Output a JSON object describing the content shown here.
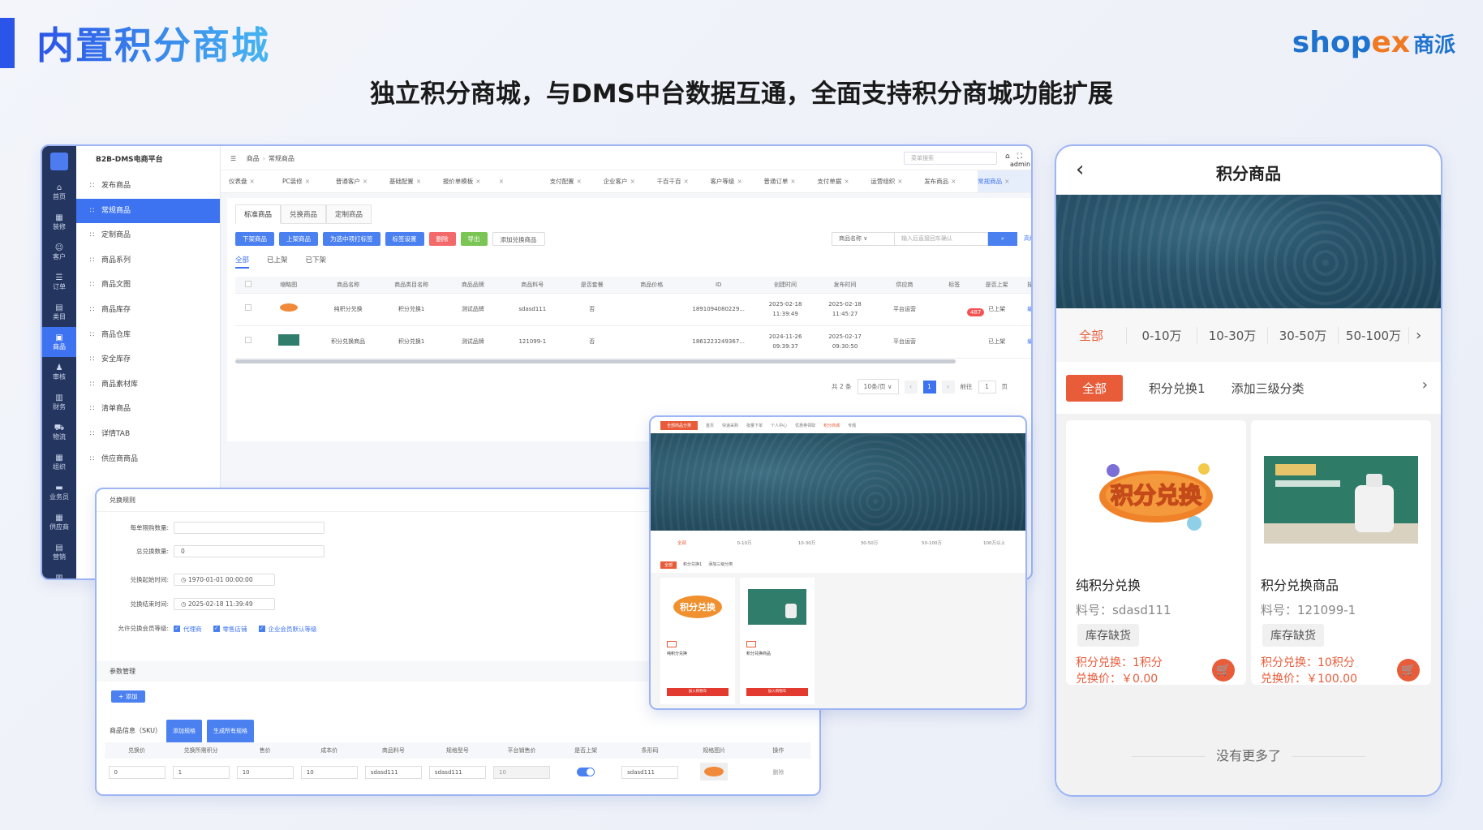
{
  "slide": {
    "title": "内置积分商城",
    "subtitle": "独立积分商城，与DMS中台数据互通，全面支持积分商城功能扩展",
    "brand": {
      "main": "shop",
      "x": "ex",
      "cn": "商派"
    }
  },
  "admin": {
    "app_title": "B2B-DMS电商平台",
    "rail": [
      {
        "icon": "home-icon",
        "glyph": "⌂",
        "label": "首页"
      },
      {
        "icon": "grid-icon",
        "glyph": "▦",
        "label": "装修"
      },
      {
        "icon": "user-icon",
        "glyph": "☺",
        "label": "客户"
      },
      {
        "icon": "order-icon",
        "glyph": "☰",
        "label": "订单"
      },
      {
        "icon": "category-icon",
        "glyph": "▤",
        "label": "类目"
      },
      {
        "icon": "goods-icon",
        "glyph": "▣",
        "label": "商品",
        "active": true
      },
      {
        "icon": "audit-icon",
        "glyph": "♟",
        "label": "审核"
      },
      {
        "icon": "finance-icon",
        "glyph": "▥",
        "label": "财务"
      },
      {
        "icon": "truck-icon",
        "glyph": "⛟",
        "label": "物流"
      },
      {
        "icon": "org-icon",
        "glyph": "▦",
        "label": "组织"
      },
      {
        "icon": "sales-icon",
        "glyph": "▬",
        "label": "业务员"
      },
      {
        "icon": "supplier-icon",
        "glyph": "▦",
        "label": "供应商"
      },
      {
        "icon": "marketing-icon",
        "glyph": "▤",
        "label": "营销"
      },
      {
        "icon": "report-icon",
        "glyph": "▥",
        "label": "报表"
      }
    ],
    "side_items": [
      "发布商品",
      "常规商品",
      "定制商品",
      "商品系列",
      "商品文图",
      "商品库存",
      "商品仓库",
      "安全库存",
      "商品素材库",
      "清单商品",
      "详情TAB",
      "供应商商品"
    ],
    "side_active": 1,
    "breadcrumb": [
      "商品",
      "常规商品"
    ],
    "search_placeholder": "菜单搜索",
    "user": "admin",
    "tabs": [
      "仪表盘",
      "PC装修",
      "普通客户",
      "基础配置",
      "报价单模板",
      "",
      "支付配置",
      "企业客户",
      "千百千百",
      "客户等级",
      "普通订单",
      "支付单据",
      "运营组织",
      "发布商品",
      "常规商品"
    ],
    "tab_active": 14,
    "subtabs": [
      "标准商品",
      "兑换商品",
      "定制商品"
    ],
    "buttons": [
      {
        "label": "下架商品",
        "style": "blue"
      },
      {
        "label": "上架商品",
        "style": "blue"
      },
      {
        "label": "为选中项打标签",
        "style": "blue"
      },
      {
        "label": "标签设置",
        "style": "blue"
      },
      {
        "label": "删除",
        "style": "red"
      },
      {
        "label": "导出",
        "style": "green"
      },
      {
        "label": "添加兑换商品",
        "style": "plain"
      }
    ],
    "filter": {
      "field": "商品名称",
      "placeholder": "输入后直接回车确认",
      "more": "高级筛选 ›"
    },
    "status_tabs": [
      "全部",
      "已上架",
      "已下架"
    ],
    "table_headers": [
      "",
      "缩略图",
      "商品名称",
      "商品类目名称",
      "商品品牌",
      "商品料号",
      "是否套餐",
      "商品价格",
      "ID",
      "创建时间",
      "发布时间",
      "供应商",
      "标签",
      "是否上架",
      "操作"
    ],
    "rows": [
      {
        "name": "纯积分兑换",
        "category": "积分兑换1",
        "brand": "测试品牌",
        "sku": "sdasd111",
        "bundle": "否",
        "price": "",
        "id": "1891094080229...",
        "created": "2025-02-18 11:39:49",
        "published": "2025-02-18 11:45:27",
        "supplier": "平台运营",
        "tag": "",
        "onsale": "已上架",
        "action": "编辑"
      },
      {
        "name": "积分兑换商品",
        "category": "积分兑换1",
        "brand": "测试品牌",
        "sku": "121099-1",
        "bundle": "否",
        "price": "",
        "id": "1861223249367...",
        "created": "2024-11-26 09:39:37",
        "published": "2025-02-17 09:30:50",
        "supplier": "平台运营",
        "tag": "",
        "onsale": "已上架",
        "action": "编辑"
      }
    ],
    "pager": {
      "total": "共 2 条",
      "size": "10条/页",
      "current": "1",
      "goto": "前往",
      "page_num": "1",
      "unit": "页"
    },
    "badge": "487"
  },
  "rules": {
    "header": "兑换规则",
    "fields": [
      {
        "label": "每单限购数量:",
        "value": ""
      },
      {
        "label": "总兑换数量:",
        "value": "0"
      },
      {
        "label": "兑换起始时间:",
        "value": "1970-01-01 00:00:00"
      },
      {
        "label": "兑换结束时间:",
        "value": "2025-02-18 11:39:49"
      }
    ],
    "member_label": "允许兑换会员等级:",
    "member_levels": [
      "代理商",
      "零售店铺",
      "企业会员默认等级"
    ],
    "param_section": "参数管理",
    "add_label": "+ 添加",
    "sku_section": "商品信息（SKU）",
    "sku_buttons": [
      "添加规格",
      "生成所有规格"
    ],
    "sku_headers": [
      "兑换价",
      "兑换所需积分",
      "售价",
      "成本价",
      "商品料号",
      "规格型号",
      "平台销售价",
      "是否上架",
      "条形码",
      "规格图片",
      "操作"
    ],
    "sku_row": {
      "price": "0",
      "points": "1",
      "sale": "10",
      "cost": "10",
      "sku": "sdasd111",
      "model": "sdasd111",
      "platform": "10",
      "barcode": "sdasd111",
      "op": "删除"
    }
  },
  "preview": {
    "nav": [
      "全部商品分类",
      "首页",
      "快速采购",
      "批量下单",
      "个人中心",
      "优惠券领取",
      "积分商城",
      "专题"
    ],
    "ranges": [
      "全部",
      "0-10万",
      "10-30万",
      "30-50万",
      "50-100万",
      "100万以上"
    ],
    "tags": [
      "全部",
      "积分兑换1",
      "添加三级分类"
    ],
    "cards": [
      {
        "name": "纯积分兑换",
        "buy": "加入购物车"
      },
      {
        "name": "积分兑换商品",
        "buy": "加入购物车"
      }
    ]
  },
  "phone": {
    "title": "积分商品",
    "ranges": [
      "全部",
      "0-10万",
      "10-30万",
      "30-50万",
      "50-100万"
    ],
    "cats": [
      "全部",
      "积分兑换1",
      "添加三级分类"
    ],
    "products": [
      {
        "name": "纯积分兑换",
        "sku": "料号：sdasd111",
        "stock": "库存缺货",
        "points": "积分兑换：1积分",
        "price": "兑换价：￥0.00"
      },
      {
        "name": "积分兑换商品",
        "sku": "料号：121099-1",
        "stock": "库存缺货",
        "points": "积分兑换：10积分",
        "price": "兑换价：￥100.00"
      }
    ],
    "no_more": "没有更多了"
  }
}
